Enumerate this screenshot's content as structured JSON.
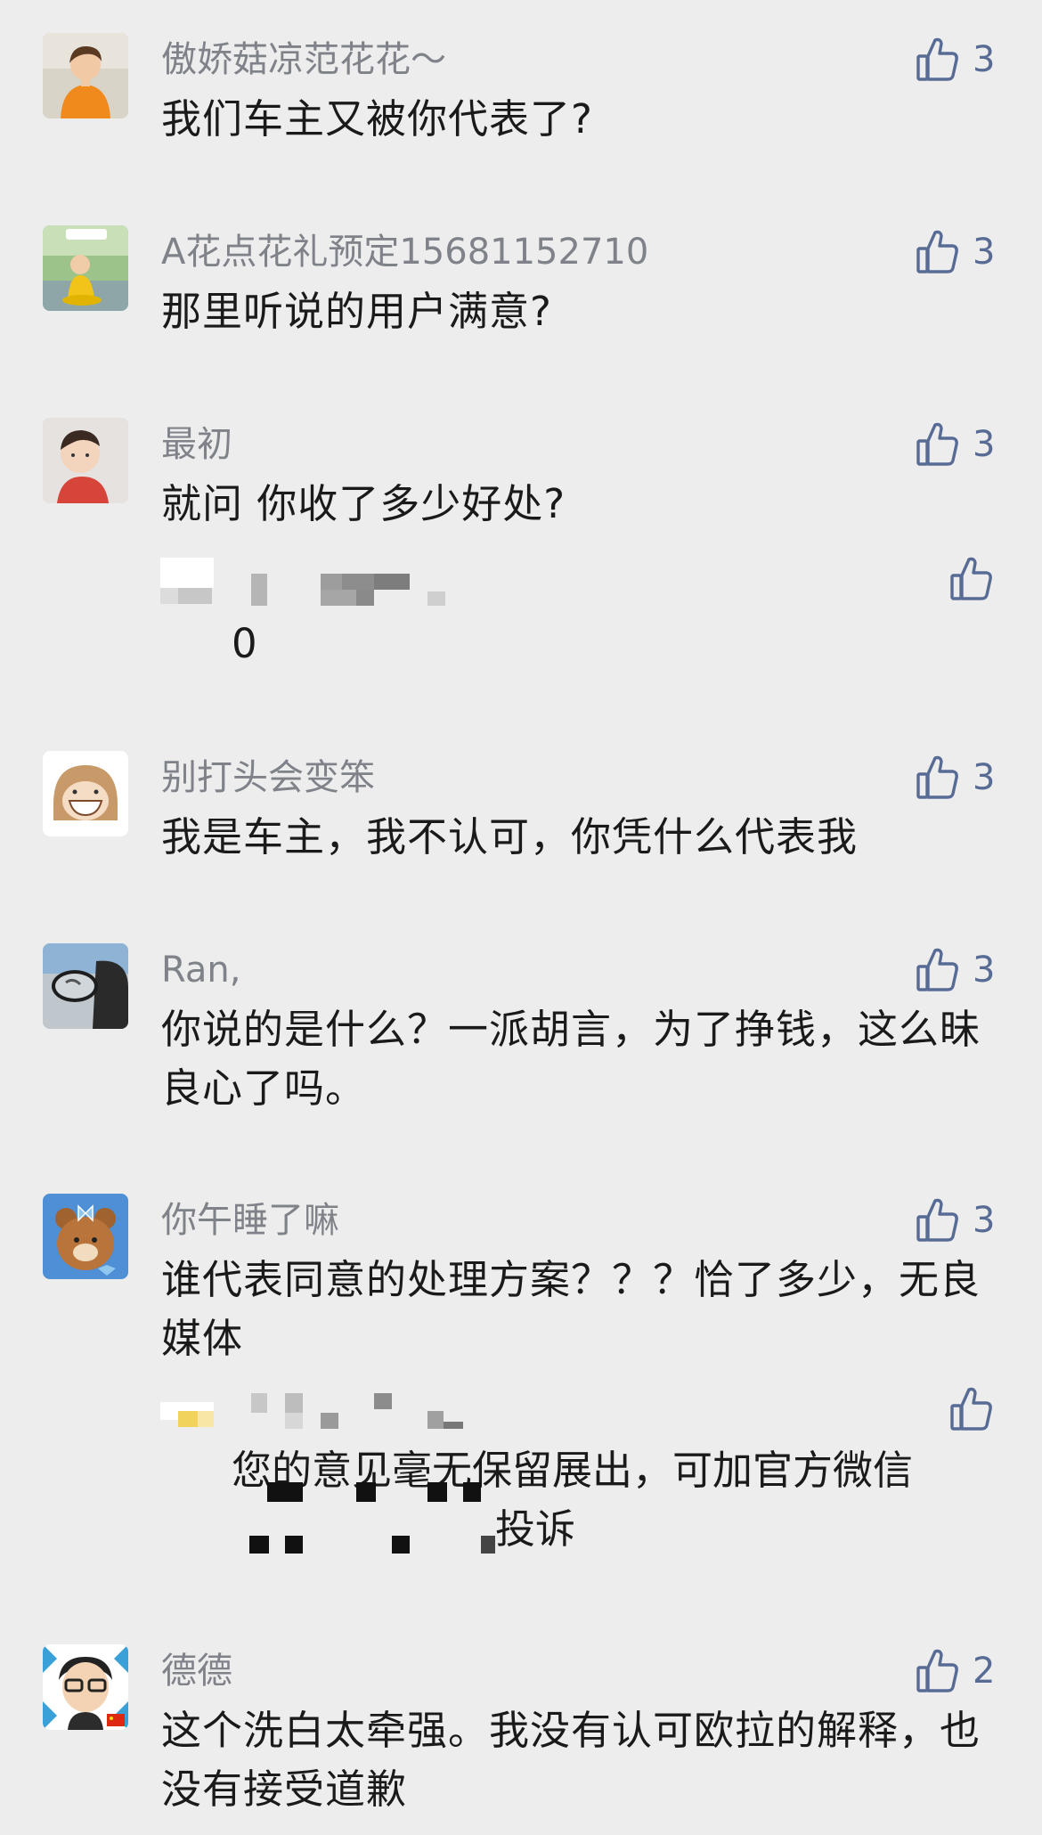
{
  "comments": [
    {
      "nickname": "傲娇菇凉范花花～",
      "text": "我们车主又被你代表了?",
      "likes": "3",
      "avatar": "avatar-woman-orange"
    },
    {
      "nickname": "A花点花礼预定15681152710",
      "text": "那里听说的用户满意?",
      "likes": "3",
      "avatar": "avatar-child-on-toy"
    },
    {
      "nickname": "最初",
      "text": "就问 你收了多少好处?",
      "likes": "3",
      "avatar": "avatar-toddler"
    },
    {
      "nickname": "别打头会变笨",
      "text": "我是车主，我不认可，你凭什么代表我",
      "likes": "3",
      "avatar": "avatar-cartoon-girl"
    },
    {
      "nickname": "Ran,",
      "text": "你说的是什么？一派胡言，为了挣钱，这么昧良心了吗。",
      "likes": "3",
      "avatar": "avatar-car-mirror"
    },
    {
      "nickname": "你午睡了嘛",
      "text": "谁代表同意的处理方案？？？恰了多少，无良媒体",
      "likes": "3",
      "avatar": "avatar-cartoon-bear"
    },
    {
      "nickname": "德德",
      "text": "这个洗白太牵强。我没有认可欧拉的解释，也没有接受道歉",
      "likes": "2",
      "avatar": "avatar-cartoon-man-glasses"
    }
  ],
  "replies": [
    {
      "text": "0"
    },
    {
      "text_line1": "您的意见毫无保留展出，可加官方微信",
      "text_line2": "投诉"
    }
  ],
  "colors": {
    "background": "#ededed",
    "nickname": "#7f8289",
    "body": "#1a1a1a",
    "like_accent": "#576b95"
  }
}
